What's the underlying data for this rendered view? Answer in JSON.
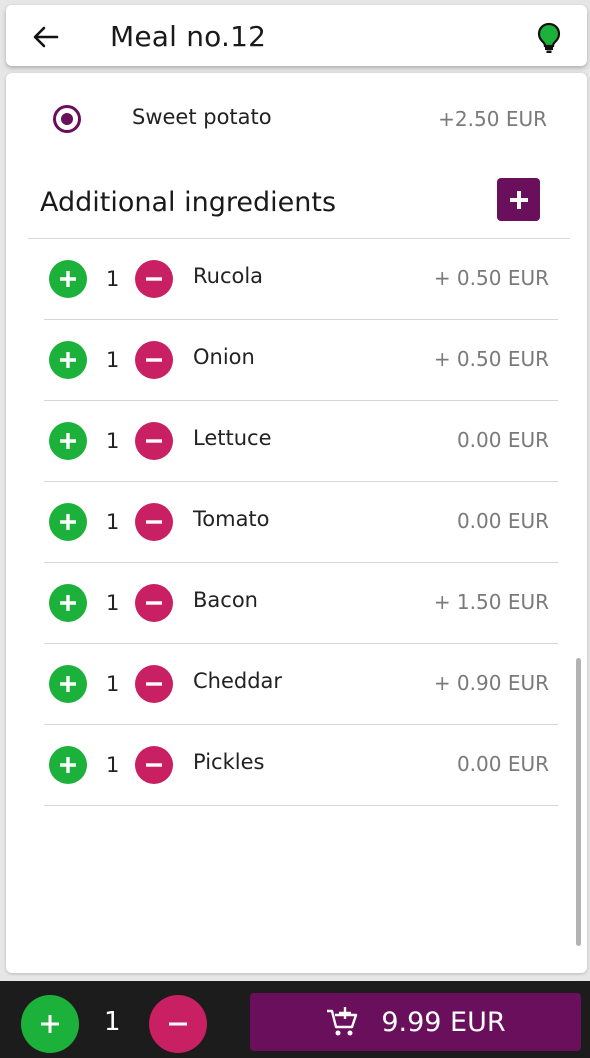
{
  "header": {
    "title": "Meal no.12",
    "back_icon": "arrow-left-icon",
    "hint_icon": "lightbulb-icon"
  },
  "option": {
    "label": "Sweet potato",
    "price": "+2.50 EUR",
    "selected": true
  },
  "section": {
    "title": "Additional ingredients"
  },
  "ingredients": [
    {
      "qty": "1",
      "name": "Rucola",
      "price": "+ 0.50 EUR"
    },
    {
      "qty": "1",
      "name": "Onion",
      "price": "+ 0.50 EUR"
    },
    {
      "qty": "1",
      "name": "Lettuce",
      "price": "0.00 EUR"
    },
    {
      "qty": "1",
      "name": "Tomato",
      "price": "0.00 EUR"
    },
    {
      "qty": "1",
      "name": "Bacon",
      "price": "+ 1.50 EUR"
    },
    {
      "qty": "1",
      "name": "Cheddar",
      "price": "+ 0.90 EUR"
    },
    {
      "qty": "1",
      "name": "Pickles",
      "price": "0.00 EUR"
    }
  ],
  "bottom": {
    "qty": "1",
    "total": "9.99 EUR",
    "cart_icon": "add-to-cart-icon"
  },
  "colors": {
    "primary": "#6a0f5c",
    "increase": "#1bb13a",
    "decrease": "#c91f63",
    "bulb": "#1bb13a",
    "bottom_bar": "#1c1c1c"
  }
}
